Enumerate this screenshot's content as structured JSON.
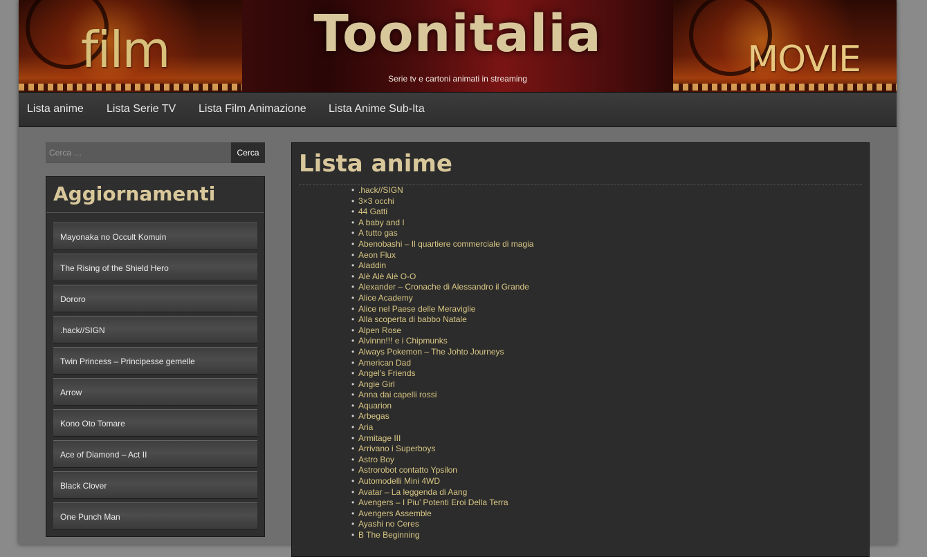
{
  "header": {
    "title": "Toonitalia",
    "tagline": "Serie tv e cartoni animati in streaming",
    "left_art_text": "film",
    "right_art_text": "MOVIE"
  },
  "nav": {
    "items": [
      {
        "label": "Lista anime"
      },
      {
        "label": "Lista Serie TV"
      },
      {
        "label": "Lista Film Animazione"
      },
      {
        "label": "Lista Anime Sub-Ita"
      }
    ]
  },
  "sidebar": {
    "search": {
      "placeholder": "Cerca …",
      "value": "",
      "button_label": "Cerca"
    },
    "updates_title": "Aggiornamenti",
    "updates": [
      "Mayonaka no Occult Komuin",
      "The Rising of the Shield Hero",
      "Dororo",
      ".hack//SIGN",
      "Twin Princess – Principesse gemelle",
      "Arrow",
      "Kono Oto Tomare",
      "Ace of Diamond – Act II",
      "Black Clover",
      "One Punch Man"
    ]
  },
  "main": {
    "title": "Lista anime",
    "list": [
      ".hack//SIGN",
      "3×3 occhi",
      "44 Gatti",
      "A baby and I",
      "A tutto gas",
      "Abenobashi – Il quartiere commerciale di magia",
      "Aeon Flux",
      "Aladdin",
      "Alè Alè Alè O-O",
      "Alexander – Cronache di Alessandro il Grande",
      "Alice Academy",
      "Alice nel Paese delle Meraviglie",
      "Alla scoperta di babbo Natale",
      "Alpen Rose",
      "Alvinnn!!! e i Chipmunks",
      "Always Pokemon – The Johto Journeys",
      "American Dad",
      "Angel’s Friends",
      "Angie Girl",
      "Anna dai capelli rossi",
      "Aquarion",
      "Arbegas",
      "Aria",
      "Armitage III",
      "Arrivano i Superboys",
      "Astro Boy",
      "Astrorobot contatto Ypsilon",
      "Automodelli Mini 4WD",
      "Avatar – La leggenda di Aang",
      "Avengers – I Piu’ Potenti Eroi Della Terra",
      "Avengers Assemble",
      "Ayashi no Ceres",
      "B The Beginning"
    ]
  },
  "colors": {
    "accent_title": "#d8c79a",
    "link": "#d9c785",
    "nav_bg": "#2e2e2e",
    "panel_bg": "#2c2c2c"
  }
}
